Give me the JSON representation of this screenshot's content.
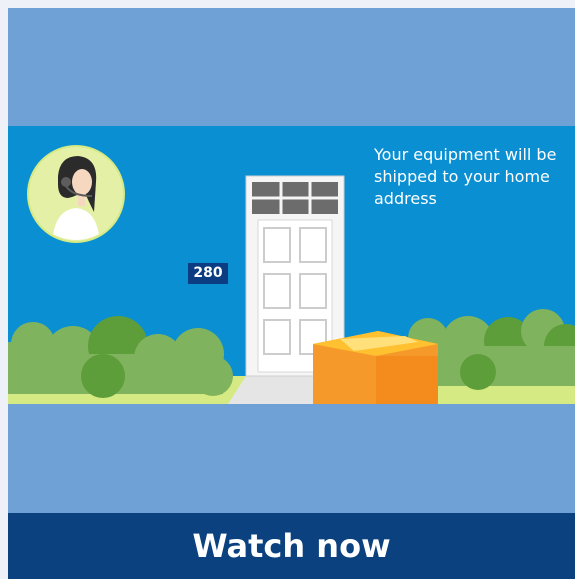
{
  "video": {
    "caption": "Your equipment will be shipped to your home address",
    "house_number": "280"
  },
  "cta": {
    "label": "Watch now"
  },
  "colors": {
    "page_background": "#6fa0d6",
    "video_background": "#0a8fd2",
    "button_background": "#0c4180",
    "box": "#f59a2a"
  }
}
